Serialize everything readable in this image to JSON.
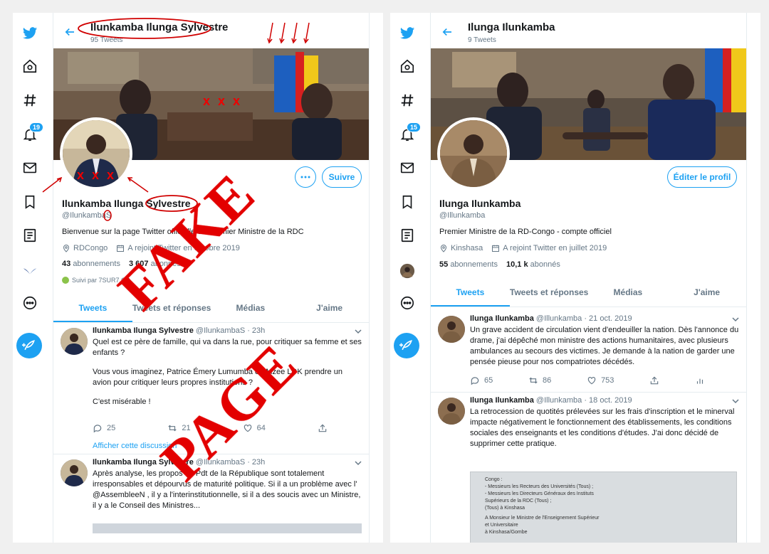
{
  "left": {
    "header": {
      "title": "Ilunkamba Ilunga Sylvestre",
      "subtitle": "95 Tweets"
    },
    "nav": {
      "notif_badge": "19"
    },
    "profile": {
      "action_label": "Suivre",
      "name": "Ilunkamba Ilunga Sylvestre",
      "handle": "@IlunkambaS",
      "bio": "Bienvenue sur la page Twitter officielle du Premier Ministre de la RDC",
      "location": "RDCongo",
      "joined": "A rejoint Twitter en octobre 2019",
      "following_count": "43",
      "following_label": "abonnements",
      "followers_count": "3 607",
      "followers_label": "abonnés",
      "followed_by": "Suivi par 7SUR7.CD"
    },
    "tabs": [
      "Tweets",
      "Tweets et réponses",
      "Médias",
      "J'aime"
    ],
    "tweets": [
      {
        "name": "Ilunkamba Ilunga Sylvestre",
        "meta": "@IlunkambaS · 23h",
        "lines": [
          "Quel est ce père de famille, qui va dans la rue, pour critiquer sa femme et ses enfants ?",
          "",
          "Vous vous imaginez, Patrice Émery Lumumba ou Mzee LDK prendre un avion pour critiquer leurs propres institutions ?",
          "",
          "C'est misérable !"
        ],
        "replies": "25",
        "retweets": "21",
        "likes": "64",
        "show_thread": "Afficher cette discussion"
      },
      {
        "name": "Ilunkamba Ilunga Sylvestre",
        "meta": "@IlunkambaS · 23h",
        "lines": [
          "Après analyse, les propos du Pdt de la République sont totalement irresponsables et dépourvus de maturité politique. Si il a un problème avec l'",
          "@AssembleeN , il y a l'interinstitutionnelle, si il a des soucis avec un Ministre, il y a le Conseil des Ministres..."
        ]
      }
    ],
    "overlay": {
      "stamp_line1": "FAKE",
      "stamp_line2": "PAGE",
      "cross_banner": "x x x",
      "cross_avatar": "x x x"
    }
  },
  "right": {
    "header": {
      "title": "Ilunga Ilunkamba",
      "subtitle": "9 Tweets"
    },
    "nav": {
      "notif_badge": "15"
    },
    "profile": {
      "action_label": "Éditer le profil",
      "name": "Ilunga Ilunkamba",
      "handle": "@Illunkamba",
      "bio": "Premier Ministre de la RD-Congo - compte officiel",
      "location": "Kinshasa",
      "joined": "A rejoint Twitter en juillet 2019",
      "following_count": "55",
      "following_label": "abonnements",
      "followers_count": "10,1 k",
      "followers_label": "abonnés"
    },
    "tabs": [
      "Tweets",
      "Tweets et réponses",
      "Médias",
      "J'aime"
    ],
    "tweets": [
      {
        "name": "Ilunga Ilunkamba",
        "meta": "@Illunkamba · 21 oct. 2019",
        "lines": [
          "Un grave accident de circulation vient d'endeuiller la nation. Dès l'annonce du drame, j'ai dépêché mon ministre des actions humanitaires, avec plusieurs ambulances au secours des victimes. Je demande à la nation de garder une pensée pieuse pour nos compatriotes décédés."
        ],
        "replies": "65",
        "retweets": "86",
        "likes": "753"
      },
      {
        "name": "Ilunga Ilunkamba",
        "meta": "@Illunkamba · 18 oct. 2019",
        "lines": [
          "La retrocession de quotités prélevées sur les frais d'inscription et le minerval impacte négativement le fonctionnement des établissements, les conditions sociales des enseignants et les conditions d'études. J'ai donc décidé de supprimer cette pratique."
        ],
        "doc_lines": [
          "Congo :",
          "- Messieurs les Recteurs des Universités (Tous) ;",
          "- Messieurs les Directeurs Généraux des Instituts",
          "  Supérieurs de la RDC (Tous) ;",
          "  (Tous) à Kinshasa",
          "A Monsieur le Ministre de l'Enseignement Supérieur",
          "et Universitaire",
          "à Kinshasa/Gombe"
        ]
      }
    ]
  },
  "colors": {
    "accent": "#1da1f2",
    "stamp": "#e30000",
    "annotation": "#d00000"
  }
}
